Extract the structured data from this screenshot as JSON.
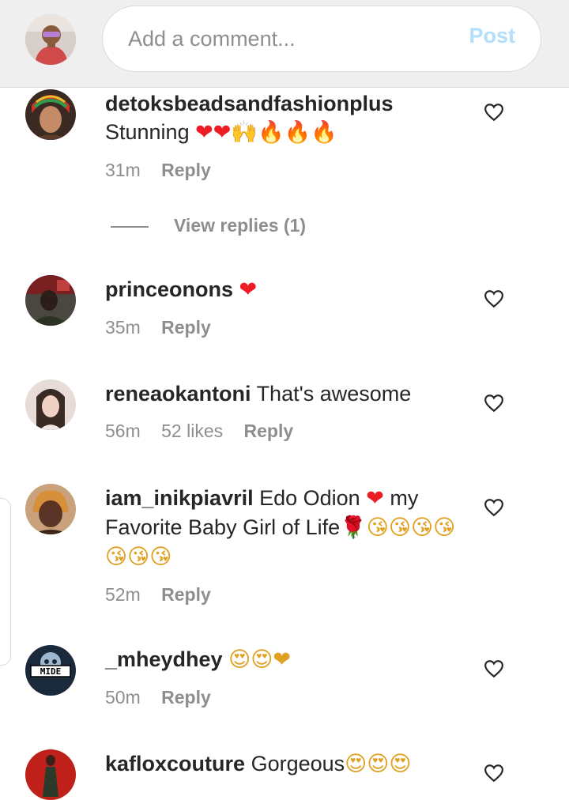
{
  "composer": {
    "placeholder": "Add a comment...",
    "post_label": "Post"
  },
  "view_replies": "View replies (1)",
  "comments": [
    {
      "username": "detoksbeadsandfashionplus",
      "text": "Stunning",
      "emojis": "❤❤🙌🔥🔥🔥",
      "time": "31m",
      "likes": "",
      "reply": "Reply"
    },
    {
      "username": "princeonons",
      "text": "",
      "emojis": "❤",
      "time": "35m",
      "likes": "",
      "reply": "Reply"
    },
    {
      "username": "reneaokantoni",
      "text": "That's awesome",
      "emojis": "",
      "time": "56m",
      "likes": "52 likes",
      "reply": "Reply"
    },
    {
      "username": "iam_inikpiavril",
      "text": "Edo Odion",
      "emojis": "❤",
      "text2": "my Favorite Baby Girl of Life",
      "emojis2": "🌹😘😘😘😘😘😘😘",
      "time": "52m",
      "likes": "",
      "reply": "Reply"
    },
    {
      "username": "_mheydhey",
      "text": "",
      "emojis": "😍😍❤",
      "time": "50m",
      "likes": "",
      "reply": "Reply"
    },
    {
      "username": "kafloxcouture",
      "text": "Gorgeous",
      "emojis": "😍😍😍",
      "time": "",
      "likes": "",
      "reply": ""
    }
  ],
  "avatar_badge": "MIDE",
  "colors": {
    "topbar_bg": "#efefef",
    "post_disabled": "#b2dffc",
    "secondary_text": "#8e8e8e",
    "heart_red": "#ed1c24"
  }
}
